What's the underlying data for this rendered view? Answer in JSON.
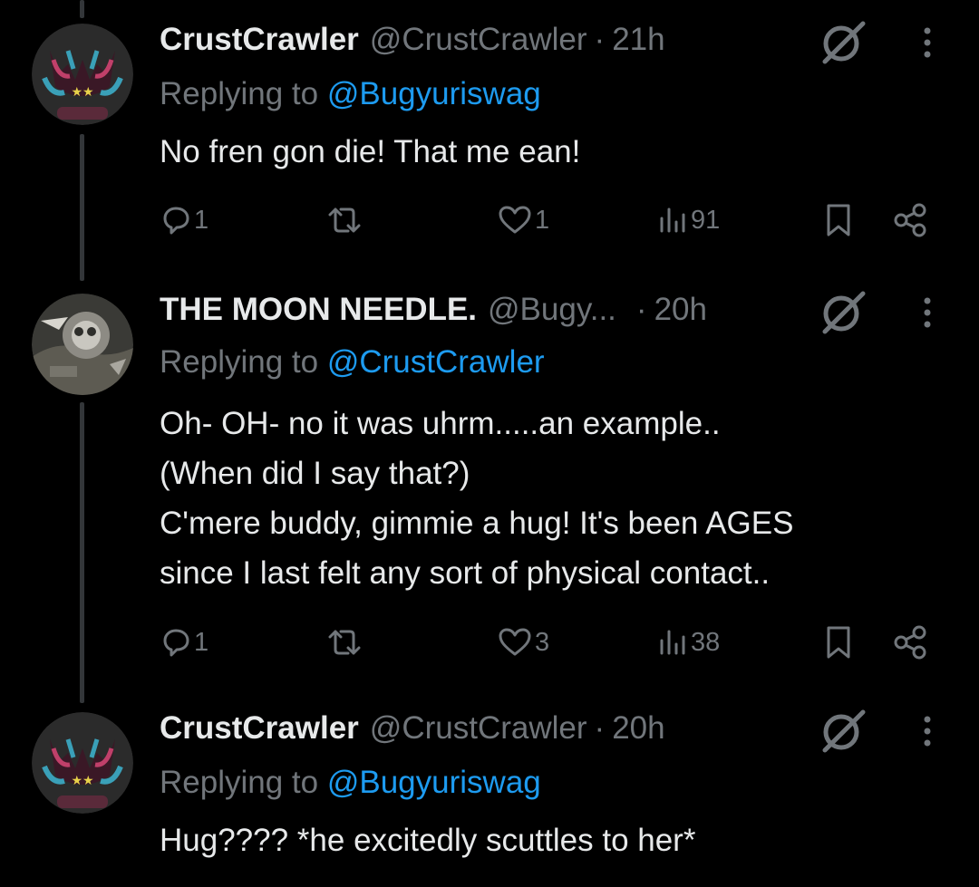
{
  "colors": {
    "background": "#000000",
    "primary_text": "#e7e9ea",
    "secondary_text": "#71767b",
    "mention": "#1d9bf0",
    "thread_line": "#333639"
  },
  "tweets": [
    {
      "display_name": "CrustCrawler",
      "handle": "@CrustCrawler",
      "separator": "·",
      "time": "21h",
      "replying_prefix": "Replying to",
      "replying_to": "@Bugyuriswag",
      "body": [
        "No fren gon die! That me ean!"
      ],
      "replies": "1",
      "retweets": "",
      "likes": "1",
      "views": "91",
      "avatar": "crab-avatar"
    },
    {
      "display_name": "THE MOON NEEDLE.",
      "handle": "@Bugy...",
      "separator": "·",
      "time": "20h",
      "replying_prefix": "Replying to",
      "replying_to": "@CrustCrawler",
      "body": [
        "Oh- OH- no it was uhrm.....an example..",
        "(When did I say that?)",
        "C'mere buddy, gimmie a hug! It's been AGES",
        "since I last felt any sort of physical contact.."
      ],
      "replies": "1",
      "retweets": "",
      "likes": "3",
      "views": "38",
      "avatar": "moon-avatar"
    },
    {
      "display_name": "CrustCrawler",
      "handle": "@CrustCrawler",
      "separator": "·",
      "time": "20h",
      "replying_prefix": "Replying to",
      "replying_to": "@Bugyuriswag",
      "body": [
        "Hug???? *he excitedly scuttles to her*"
      ],
      "avatar": "crab-avatar"
    }
  ],
  "icons": {
    "reply": "reply-icon",
    "retweet": "retweet-icon",
    "like": "heart-icon",
    "views": "views-icon",
    "bookmark": "bookmark-icon",
    "share": "share-icon",
    "grok": "grok-icon",
    "more": "more-icon"
  }
}
